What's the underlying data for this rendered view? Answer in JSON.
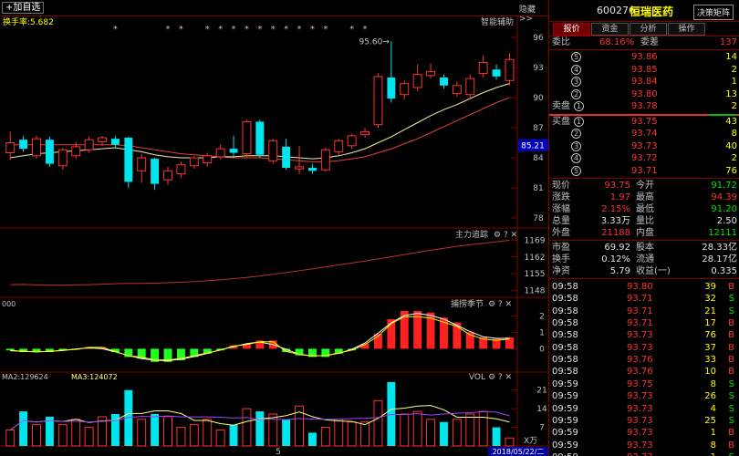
{
  "toolbar": {
    "add_label": "+加自选",
    "hide_label": "隐藏 >>"
  },
  "chart_header": {
    "turnover": "换手率:5.682",
    "smart_label": "智能辅助",
    "max_label": "95.60→"
  },
  "price_axis": [
    "96",
    "93",
    "90",
    "87",
    "84",
    "81",
    "78"
  ],
  "current_price_tag": "85.21",
  "main_force_panel": {
    "title": "主力追踪",
    "ticks": [
      "1169",
      "1162",
      "1155",
      "1148"
    ]
  },
  "macd_panel": {
    "title": "捕捞季节",
    "left_label": "000",
    "ticks": [
      "2",
      "1",
      "0"
    ]
  },
  "vol_panel": {
    "ma2": "MA2:129624",
    "ma3": "MA3:124072",
    "title": "VOL",
    "ticks": [
      "21",
      "14",
      "7"
    ],
    "unit": "X万"
  },
  "bottom_axis": {
    "label": "5",
    "date": "2018/05/22/二"
  },
  "quote": {
    "code": "600276",
    "name": "恒瑞医药",
    "decision_btn": "决策矩阵",
    "tabs": [
      "报价",
      "资金",
      "分析",
      "操作"
    ],
    "wei_bi": {
      "label": "委比",
      "value": "68.16%",
      "diff_label": "委差",
      "diff": "137"
    },
    "sell": [
      {
        "n": "5",
        "price": "93.86",
        "vol": "14"
      },
      {
        "n": "4",
        "price": "93.85",
        "vol": "2"
      },
      {
        "n": "3",
        "price": "93.84",
        "vol": "1"
      },
      {
        "n": "2",
        "price": "93.80",
        "vol": "13"
      },
      {
        "n": "1",
        "price": "93.78",
        "vol": "2",
        "label": "卖盘"
      }
    ],
    "buy": [
      {
        "n": "1",
        "price": "93.75",
        "vol": "43",
        "label": "买盘"
      },
      {
        "n": "2",
        "price": "93.74",
        "vol": "8"
      },
      {
        "n": "3",
        "price": "93.73",
        "vol": "40"
      },
      {
        "n": "4",
        "price": "93.72",
        "vol": "2"
      },
      {
        "n": "5",
        "price": "93.71",
        "vol": "76"
      }
    ],
    "stats": [
      {
        "l1": "现价",
        "v1": "93.75",
        "c1": "red",
        "l2": "今开",
        "v2": "91.72",
        "c2": "green"
      },
      {
        "l1": "涨跌",
        "v1": "1.97",
        "c1": "red",
        "l2": "最高",
        "v2": "94.39",
        "c2": "red"
      },
      {
        "l1": "涨幅",
        "v1": "2.15%",
        "c1": "red",
        "l2": "最低",
        "v2": "91.20",
        "c2": "green"
      },
      {
        "l1": "总量",
        "v1": "3.33万",
        "c1": "white",
        "l2": "量比",
        "v2": "2.50",
        "c2": "white"
      },
      {
        "l1": "外盘",
        "v1": "21188",
        "c1": "red",
        "l2": "内盘",
        "v2": "12111",
        "c2": "green"
      }
    ],
    "stats2": [
      {
        "l1": "市盈",
        "v1": "69.92",
        "l2": "股本",
        "v2": "28.33亿"
      },
      {
        "l1": "换手",
        "v1": "0.12%",
        "l2": "流通",
        "v2": "28.17亿"
      },
      {
        "l1": "净资",
        "v1": "5.79",
        "l2": "收益(一)",
        "v2": "0.335"
      }
    ],
    "ticks": [
      {
        "t": "09:58",
        "p": "93.80",
        "v": "39",
        "d": "B"
      },
      {
        "t": "09:58",
        "p": "93.71",
        "v": "32",
        "d": "S"
      },
      {
        "t": "09:58",
        "p": "93.71",
        "v": "21",
        "d": "S"
      },
      {
        "t": "09:58",
        "p": "93.71",
        "v": "17",
        "d": "B"
      },
      {
        "t": "09:58",
        "p": "93.73",
        "v": "76",
        "d": "B"
      },
      {
        "t": "09:58",
        "p": "93.73",
        "v": "37",
        "d": "B"
      },
      {
        "t": "09:58",
        "p": "93.76",
        "v": "33",
        "d": "B"
      },
      {
        "t": "09:58",
        "p": "93.76",
        "v": "10",
        "d": "B"
      },
      {
        "t": "09:59",
        "p": "93.75",
        "v": "8",
        "d": "S"
      },
      {
        "t": "09:59",
        "p": "93.73",
        "v": "26",
        "d": "S"
      },
      {
        "t": "09:59",
        "p": "93.73",
        "v": "4",
        "d": "S"
      },
      {
        "t": "09:59",
        "p": "93.73",
        "v": "25",
        "d": "S"
      },
      {
        "t": "09:59",
        "p": "93.73",
        "v": "1",
        "d": "B"
      },
      {
        "t": "09:59",
        "p": "93.73",
        "v": "8",
        "d": "B"
      },
      {
        "t": "09:59",
        "p": "93.73",
        "v": "1",
        "d": "S"
      },
      {
        "t": "09:59",
        "p": "93.74",
        "v": "59",
        "d": "B"
      }
    ]
  },
  "colors": {
    "up": "#ff3232",
    "down": "#00e5ee",
    "ma5": "#f0f0a0",
    "ma10": "#e04040",
    "grid": "#800000"
  },
  "chart_data": {
    "type": "candlestick",
    "ylim": [
      77,
      97
    ],
    "candles": [
      [
        84.5,
        85.5,
        83.8,
        86.6
      ],
      [
        85.8,
        84.9,
        84.6,
        86.2
      ],
      [
        84.2,
        85.9,
        83.9,
        86.2
      ],
      [
        85.8,
        83.4,
        83.1,
        86.1
      ],
      [
        83.2,
        84.8,
        82.8,
        85.0
      ],
      [
        84.2,
        85.1,
        83.9,
        85.6
      ],
      [
        84.8,
        85.8,
        84.5,
        86.1
      ],
      [
        85.6,
        86.0,
        85.2,
        86.2
      ],
      [
        85.9,
        85.3,
        85.0,
        86.2
      ],
      [
        86.0,
        81.6,
        81.0,
        86.1
      ],
      [
        82.7,
        84.0,
        81.5,
        84.4
      ],
      [
        83.9,
        81.4,
        80.8,
        84.0
      ],
      [
        81.8,
        82.7,
        81.3,
        83.1
      ],
      [
        82.4,
        83.3,
        82.0,
        83.6
      ],
      [
        83.2,
        84.0,
        82.9,
        84.2
      ],
      [
        83.5,
        84.2,
        83.1,
        84.5
      ],
      [
        84.1,
        84.9,
        83.8,
        85.3
      ],
      [
        84.9,
        84.5,
        84.0,
        86.2
      ],
      [
        84.4,
        87.6,
        84.0,
        87.8
      ],
      [
        87.6,
        84.3,
        84.0,
        87.8
      ],
      [
        83.7,
        85.7,
        83.4,
        85.9
      ],
      [
        85.1,
        83.0,
        82.8,
        85.9
      ],
      [
        82.9,
        83.1,
        82.4,
        85.2
      ],
      [
        83.0,
        82.7,
        82.4,
        83.4
      ],
      [
        82.8,
        84.8,
        82.6,
        85.0
      ],
      [
        84.6,
        85.7,
        84.3,
        85.9
      ],
      [
        85.2,
        86.2,
        84.9,
        86.4
      ],
      [
        86.3,
        86.6,
        86.0,
        87.0
      ],
      [
        87.3,
        92.1,
        87.0,
        92.4
      ],
      [
        92.0,
        89.9,
        89.5,
        95.6
      ],
      [
        90.3,
        91.4,
        89.8,
        91.7
      ],
      [
        91.0,
        92.3,
        90.6,
        93.3
      ],
      [
        92.2,
        92.6,
        91.9,
        93.4
      ],
      [
        92.0,
        91.2,
        90.9,
        92.3
      ],
      [
        90.4,
        91.2,
        90.1,
        91.6
      ],
      [
        90.3,
        91.9,
        89.9,
        92.3
      ],
      [
        92.4,
        93.5,
        92.0,
        94.2
      ],
      [
        92.8,
        92.1,
        91.8,
        93.3
      ],
      [
        91.7,
        93.8,
        91.2,
        94.4
      ]
    ],
    "ma5": [
      84.0,
      84.2,
      84.4,
      84.5,
      84.6,
      84.7,
      84.8,
      84.9,
      85.0,
      84.8,
      84.6,
      84.3,
      84.1,
      84.0,
      84.0,
      84.0,
      84.1,
      84.1,
      84.2,
      84.2,
      84.2,
      84.1,
      84.0,
      83.9,
      84.0,
      84.2,
      84.5,
      84.9,
      85.5,
      86.1,
      86.8,
      87.5,
      88.2,
      88.8,
      89.3,
      89.9,
      90.5,
      91.0,
      91.4
    ],
    "ma10": [
      85.3,
      85.3,
      85.3,
      85.3,
      85.3,
      85.3,
      85.3,
      85.3,
      85.3,
      85.2,
      85.0,
      84.8,
      84.6,
      84.4,
      84.3,
      84.2,
      84.1,
      84.0,
      84.0,
      84.0,
      83.9,
      83.8,
      83.7,
      83.6,
      83.6,
      83.7,
      83.9,
      84.1,
      84.5,
      84.9,
      85.4,
      85.9,
      86.5,
      87.1,
      87.7,
      88.3,
      88.9,
      89.5,
      90.0
    ],
    "main_force": [
      1150.5,
      1150.6,
      1150.4,
      1150.3,
      1150.3,
      1150.4,
      1150.5,
      1150.7,
      1150.9,
      1151.0,
      1151.0,
      1151.1,
      1151.3,
      1151.5,
      1151.8,
      1152.1,
      1152.5,
      1153.0,
      1153.5,
      1154.1,
      1154.8,
      1155.5,
      1156.3,
      1157.1,
      1157.9,
      1158.7,
      1159.5,
      1160.3,
      1161.2,
      1162.1,
      1163.0,
      1163.9,
      1164.8,
      1165.6,
      1166.4,
      1167.1,
      1167.7,
      1168.3,
      1168.9
    ],
    "macd": [
      -0.1,
      -0.2,
      -0.2,
      -0.2,
      -0.1,
      -0.05,
      0.1,
      0.1,
      -0.2,
      -0.5,
      -0.6,
      -0.8,
      -0.8,
      -0.7,
      -0.5,
      -0.3,
      -0.1,
      0.2,
      0.3,
      0.5,
      0.5,
      -0.2,
      -0.4,
      -0.5,
      -0.5,
      -0.3,
      -0.1,
      0.3,
      0.9,
      1.8,
      2.3,
      2.3,
      2.2,
      1.9,
      1.6,
      1.0,
      0.7,
      0.6,
      0.7
    ],
    "volume": [
      6,
      13,
      8,
      11,
      8,
      10,
      7,
      11,
      12,
      21,
      10,
      12,
      11,
      7,
      8,
      10,
      6,
      8,
      14,
      13,
      12,
      10,
      15,
      5,
      7,
      10,
      9,
      9,
      17,
      24,
      12,
      13,
      10,
      9,
      10,
      12,
      13,
      7,
      3
    ]
  }
}
